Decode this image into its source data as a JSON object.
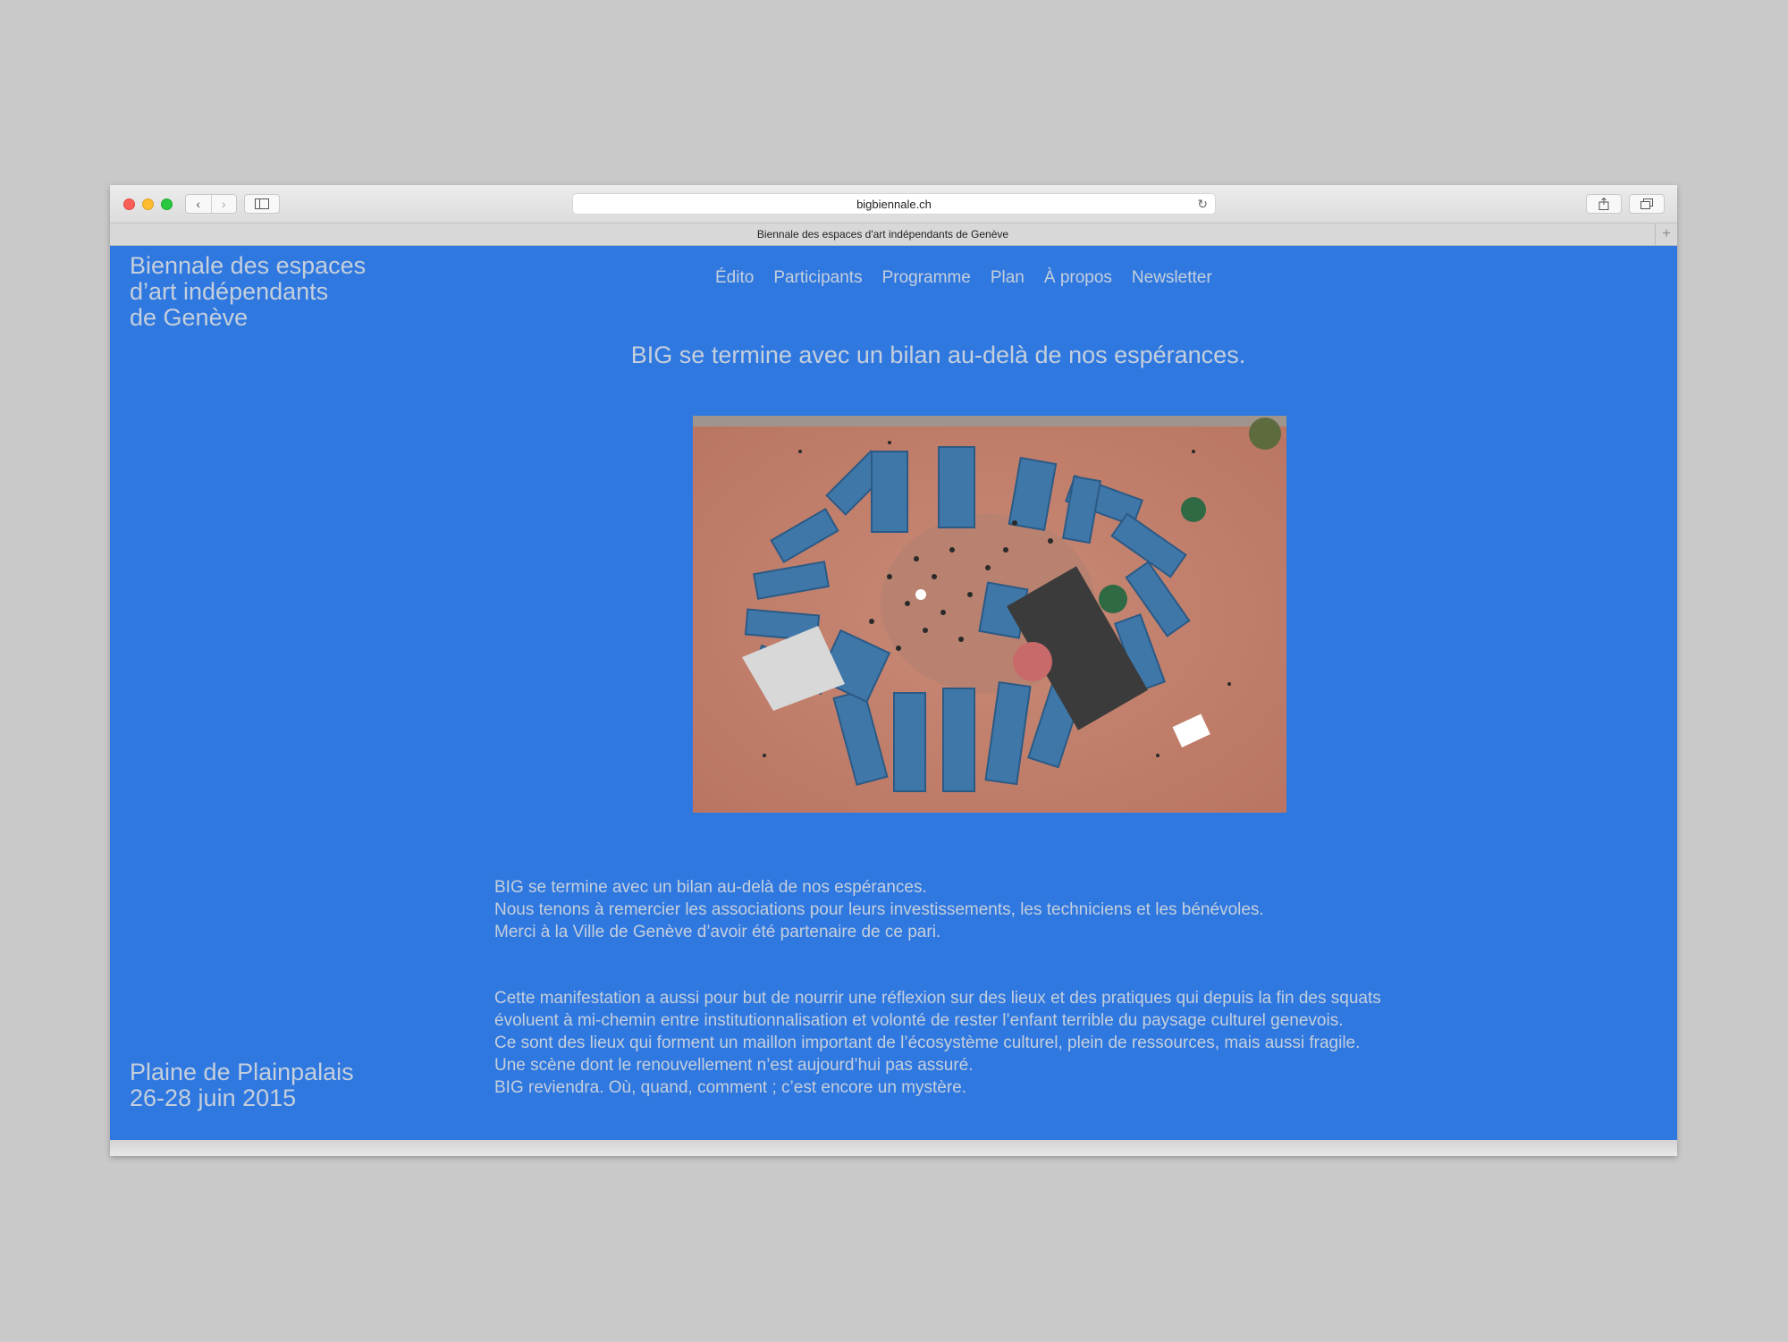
{
  "browser": {
    "url": "bigbiennale.ch",
    "tab_title": "Biennale des espaces d'art indépendants de Genève",
    "new_tab_label": "+",
    "back_label": "‹",
    "forward_label": "›"
  },
  "site": {
    "title_lines": [
      "Biennale des espaces",
      "d’art indépendants",
      "de Genève"
    ],
    "nav": [
      "Édito",
      "Participants",
      "Programme",
      "Plan",
      "À propos",
      "Newsletter"
    ],
    "headline": "BIG se termine avec un bilan au-delà de nos espérances.",
    "photo_alt": "Vue aérienne de containers bleus disposés en cercle",
    "paragraph1": [
      "BIG se termine avec un bilan au-delà de nos espérances.",
      "Nous tenons à remercier les associations pour leurs investissements, les techniciens et les bénévoles.",
      "Merci à la Ville de Genève d’avoir été partenaire de ce pari."
    ],
    "paragraph2": [
      "Cette manifestation a aussi pour but de nourrir une réflexion sur des lieux et des pratiques qui depuis la fin des squats",
      "évoluent à mi-chemin entre institutionnalisation et volonté de rester l’enfant terrible du paysage culturel genevois.",
      "Ce sont des lieux qui forment un maillon important de l’écosystème culturel, plein de ressources, mais aussi fragile.",
      "Une scène dont le renouvellement n’est aujourd’hui pas assuré.",
      "BIG reviendra. Où, quand, comment ; c’est encore un mystère."
    ],
    "venue_lines": [
      "Plaine de Plainpalais",
      "26-28 juin 2015"
    ]
  },
  "colors": {
    "page_background": "#2f78e0",
    "text": "#c5cfdc",
    "desktop": "#c9c9c9"
  }
}
